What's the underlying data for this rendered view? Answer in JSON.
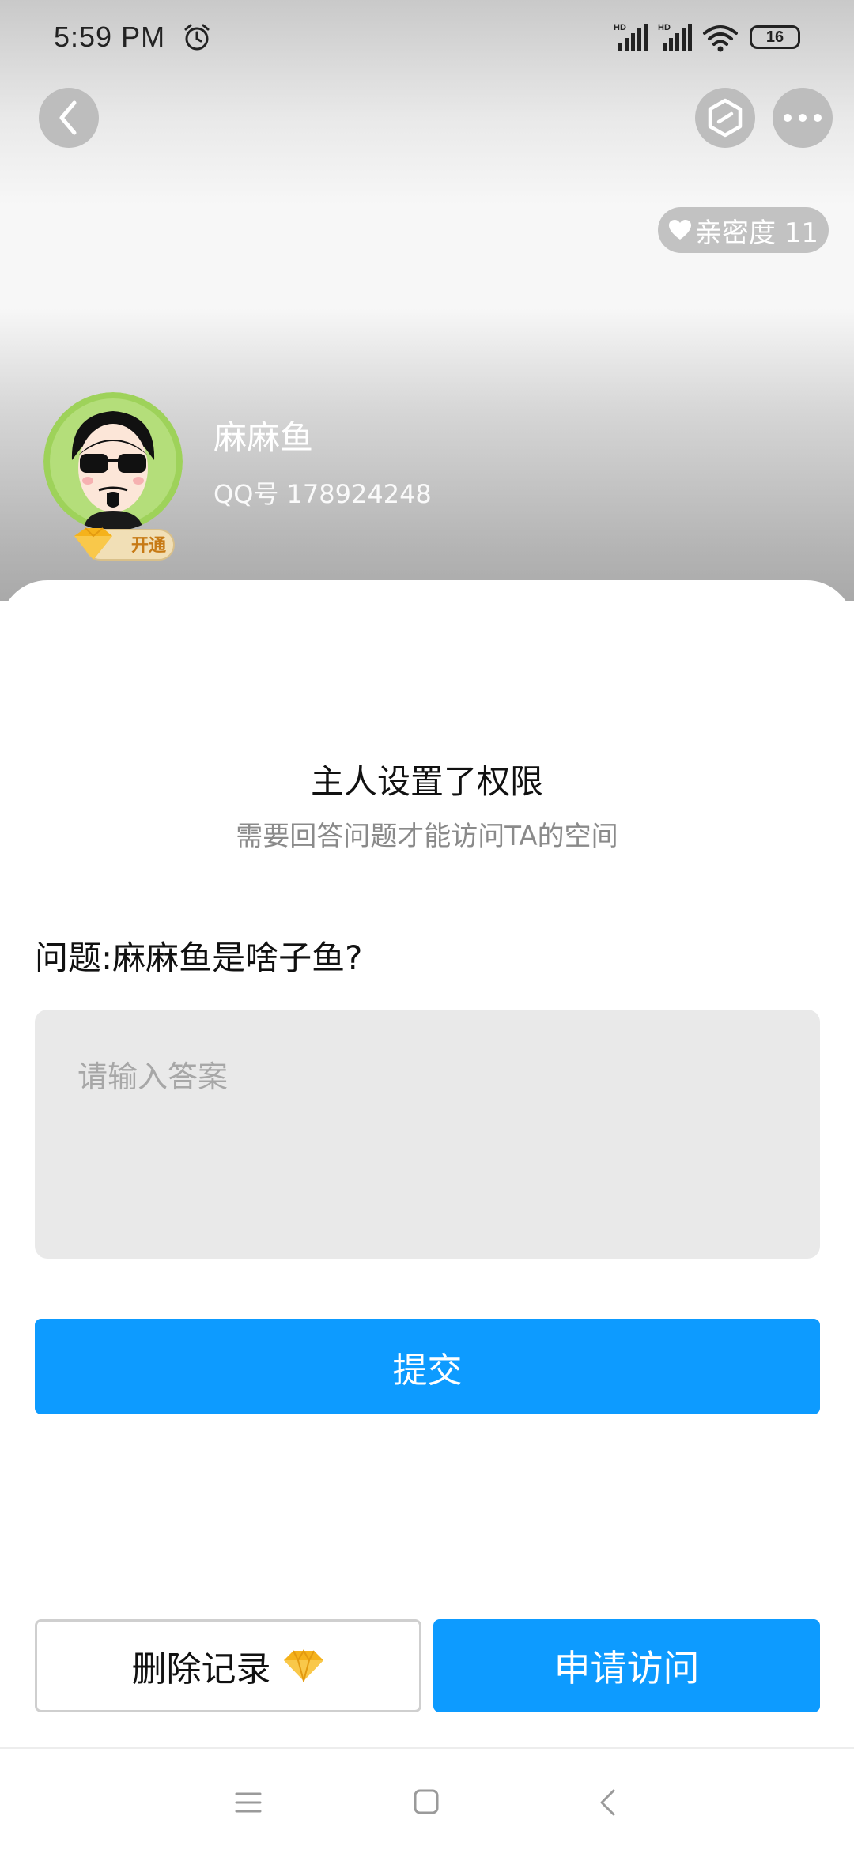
{
  "status_bar": {
    "time": "5:59 PM",
    "battery": "16",
    "icons": [
      "alarm-icon",
      "hd-signal-icon",
      "hd-signal-icon",
      "wifi-icon",
      "battery-icon"
    ]
  },
  "header": {
    "back_icon": "chevron-left-icon",
    "shield_icon": "hexagon-slash-icon",
    "more_icon": "more-dots-icon",
    "intimacy_label": "亲密度 11"
  },
  "profile": {
    "nickname": "麻麻鱼",
    "qq_number": "QQ号 178924248",
    "vip_label": "开通"
  },
  "permission": {
    "title": "主人设置了权限",
    "subtitle": "需要回答问题才能访问TA的空间",
    "question": "问题:麻麻鱼是啥子鱼?",
    "answer_placeholder": "请输入答案",
    "submit_label": "提交"
  },
  "footer": {
    "delete_label": "删除记录",
    "apply_label": "申请访问"
  },
  "colors": {
    "accent": "#0d9bff",
    "input_bg": "#e9e9e9"
  }
}
